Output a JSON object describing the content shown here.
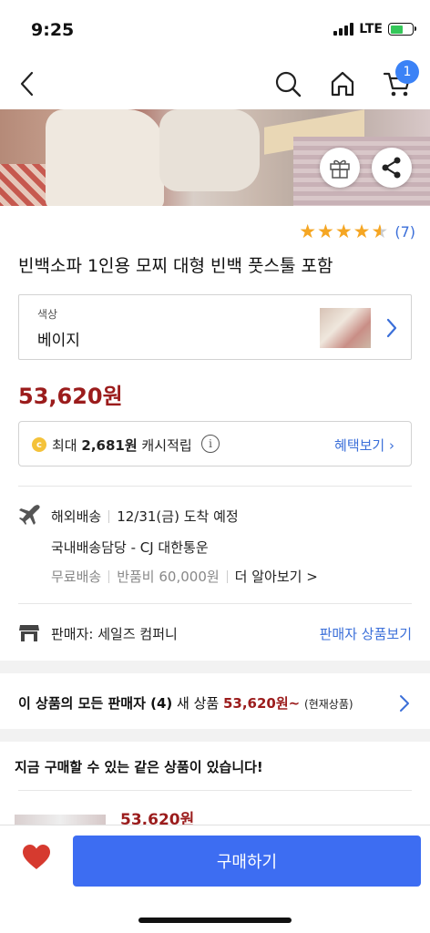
{
  "status_bar": {
    "time": "9:25",
    "network": "LTE",
    "battery_level": 0.6
  },
  "header": {
    "cart_count": "1"
  },
  "product": {
    "rating": 4.5,
    "review_count": "(7)",
    "title": "빈백소파 1인용 모찌 대형 빈백 풋스툴 포함",
    "option": {
      "label": "색상",
      "value": "베이지"
    },
    "price": "53,620원"
  },
  "cash": {
    "prefix": "최대",
    "amount": "2,681원",
    "suffix": "캐시적립",
    "benefit_link": "혜택보기 ›"
  },
  "shipping": {
    "type": "해외배송",
    "arrival": "12/31(금) 도착 예정",
    "carrier": "국내배송담당 - CJ 대한통운",
    "free": "무료배송",
    "return_fee": "반품비 60,000원",
    "more": "더 알아보기 >"
  },
  "seller": {
    "label": "판매자: 세일즈 컴퍼니",
    "link": "판매자 상품보기"
  },
  "all_sellers": {
    "prefix": "이 상품의 모든 판매자 (4)",
    "new_label": "새 상품",
    "price": "53,620원~",
    "note": "(현재상품)"
  },
  "same_products": {
    "title": "지금 구매할 수 있는 같은 상품이 있습니다!",
    "price": "53,620원"
  },
  "bottom_bar": {
    "buy_label": "구매하기"
  },
  "colors": {
    "accent": "#3d6df2",
    "price_red": "#9b1c1c",
    "link_blue": "#3b6fd9",
    "star": "#f5a623"
  }
}
